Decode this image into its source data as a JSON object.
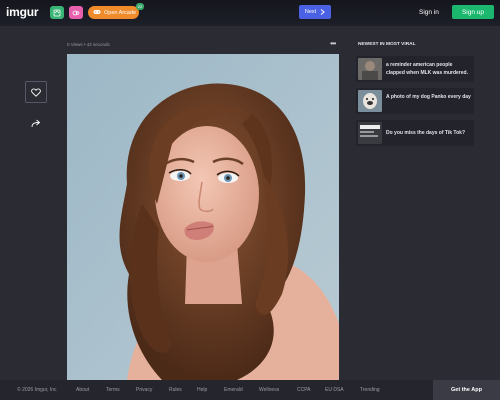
{
  "header": {
    "logo": "imgur",
    "arcade_label": "Open Arcade",
    "arcade_badge": "22",
    "next_label": "Next",
    "signin_label": "Sign in",
    "signup_label": "Sign up"
  },
  "post": {
    "meta": "0 Views • 42 seconds"
  },
  "sidebar": {
    "title": "NEWEST IN MOST VIRAL",
    "items": [
      {
        "text": "a reminder american people clapped when MLK was murdered."
      },
      {
        "text": "A photo of my dog Panko every day"
      },
      {
        "text": "Do you miss the days of Tik Tok?"
      }
    ]
  },
  "footer": {
    "items": [
      "© 2026 Imgur, Inc",
      "About",
      "Terms",
      "Privacy",
      "Rules",
      "Help",
      "Emerald",
      "Wellness",
      "CCPA",
      "EU DSA",
      "Trending"
    ],
    "get_app": "Get the App"
  },
  "colors": {
    "background": "#2b2c33",
    "next_button": "#4a61e3",
    "signup_button": "#1bb76e",
    "arcade_button": "#f08b2b"
  },
  "icons": [
    "imgur-logo",
    "upload-icon",
    "gallery-icon",
    "gamepad-icon",
    "chevron-right-icon",
    "more-icon",
    "heart-icon",
    "share-icon"
  ]
}
